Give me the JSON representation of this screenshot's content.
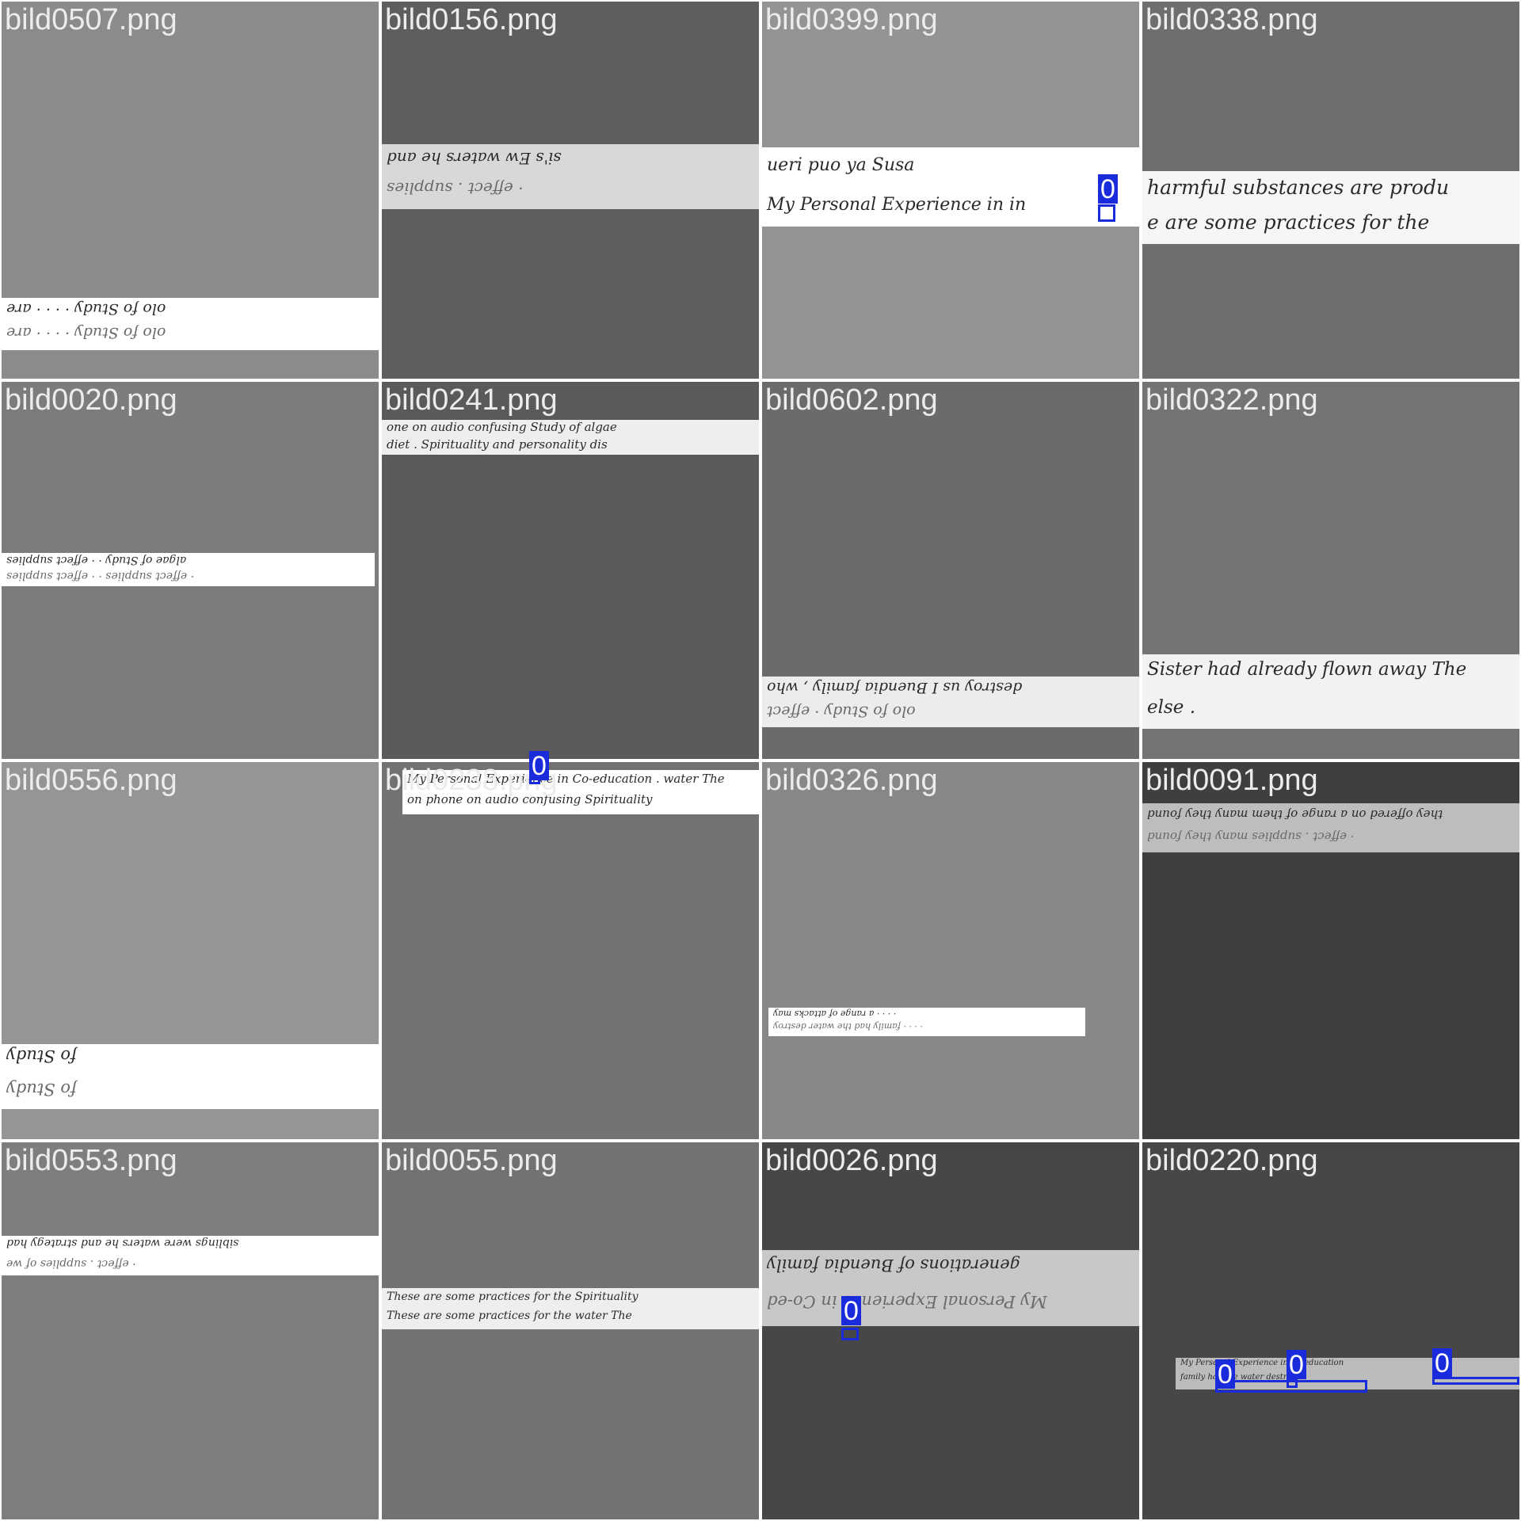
{
  "title": "",
  "tiles": [
    {
      "name": "bild0507.png",
      "bg": "#8b8b8b",
      "strip_color": "#ffffff",
      "lines": [
        "olo   fo   Study       ·     ·    ·    ·      are",
        "olo   fo   Study       ·     ·    ·    ·      are"
      ],
      "flip": true
    },
    {
      "name": "bild0156.png",
      "bg": "#5e5e5e",
      "strip_color": "#d8d8d8",
      "lines": [
        "si's   Ew   waters   he   and",
        "·   effect .   supplies"
      ],
      "flip": true
    },
    {
      "name": "bild0399.png",
      "bg": "#949494",
      "strip_color": "#ffffff",
      "lines": [
        "ueri      puo      ya      Susa",
        "My   Personal   Experience   in   in"
      ],
      "flip": false
    },
    {
      "name": "bild0338.png",
      "bg": "#6e6e6e",
      "strip_color": "#f6f6f6",
      "lines": [
        "harmful   substances   are   produ",
        "e   are   some   practices   for   the"
      ],
      "flip": false
    },
    {
      "name": "bild0020.png",
      "bg": "#7c7c7c",
      "strip_color": "#ffffff",
      "lines": [
        "algae   of   Study      ·     · effect   supplies",
        "· effect   supplies      ·     · effect   supplies"
      ],
      "flip": true
    },
    {
      "name": "bild0241.png",
      "bg": "#5a5a5a",
      "strip_color": "#eeeeee",
      "lines": [
        "one   on   audio   confusing     Study   of   algae",
        "diet .        Spirituality   and   personality   dis"
      ],
      "flip": false
    },
    {
      "name": "bild0602.png",
      "bg": "#6b6b6b",
      "strip_color": "#ececec",
      "lines": [
        "destroy   us   I        Buendia   family ,   who",
        "olo   fo   Study          · effect"
      ],
      "flip": true
    },
    {
      "name": "bild0322.png",
      "bg": "#747474",
      "strip_color": "#f2f2f2",
      "lines": [
        "Sister   had   already   flown   away   The",
        "else ."
      ],
      "flip": false
    },
    {
      "name": "bild0556.png",
      "bg": "#959595",
      "strip_color": "#ffffff",
      "lines": [
        "fo   Study",
        "fo   Study"
      ],
      "flip": true
    },
    {
      "name": "bild0238.png",
      "bg": "#727272",
      "strip_color": "#ffffff",
      "lines": [
        "My   Personal   Experience   in   Co-education .     water   The",
        "on   phone   on   audio   confusing     Spirituality"
      ],
      "flip": false
    },
    {
      "name": "bild0326.png",
      "bg": "#878787",
      "strip_color": "#ffffff",
      "lines": [
        "·   ·   ·   ·   a   range   of   attacks   may",
        "·   ·   ·   ·   family   had   the   water   destroy"
      ],
      "flip": true
    },
    {
      "name": "bild0091.png",
      "bg": "#3f3f3f",
      "strip_color": "#bdbdbd",
      "lines": [
        "they   offered   on   a   range   of   them   many   they   found",
        "·   effect .   supplies     many   they   found"
      ],
      "flip": true
    },
    {
      "name": "bild0553.png",
      "bg": "#7e7e7e",
      "strip_color": "#ffffff",
      "lines": [
        "siblings   were   waters   he   and      strategy   had",
        "· effect .   supplies      of   we"
      ],
      "flip": true
    },
    {
      "name": "bild0055.png",
      "bg": "#727272",
      "strip_color": "#eeeeee",
      "lines": [
        "These   are   some   practices   for   the     Spirituality",
        "These   are   some   practices   for   the     water   The"
      ],
      "flip": false
    },
    {
      "name": "bild0026.png",
      "bg": "#474747",
      "strip_color": "#c8c8c8",
      "lines": [
        "generations   of   Buendia   family",
        "My   Personal   Experience   in   Co-ed"
      ],
      "flip": true
    },
    {
      "name": "bild0220.png",
      "bg": "#474747",
      "strip_color": "#bcbcbc",
      "lines": [
        "My   Personal   Experience   in   Co-education",
        "family   had   the   water   destroy"
      ],
      "flip": false
    }
  ],
  "detections": [
    {
      "label": "0",
      "tile": "bild0399.png"
    },
    {
      "label": "0",
      "tile": "bild0238.png"
    },
    {
      "label": "0",
      "tile": "bild0026.png"
    },
    {
      "label": "0",
      "tile": "bild0220.png"
    },
    {
      "label": "0",
      "tile": "bild0220.png"
    },
    {
      "label": "0",
      "tile": "bild0220.png"
    }
  ]
}
